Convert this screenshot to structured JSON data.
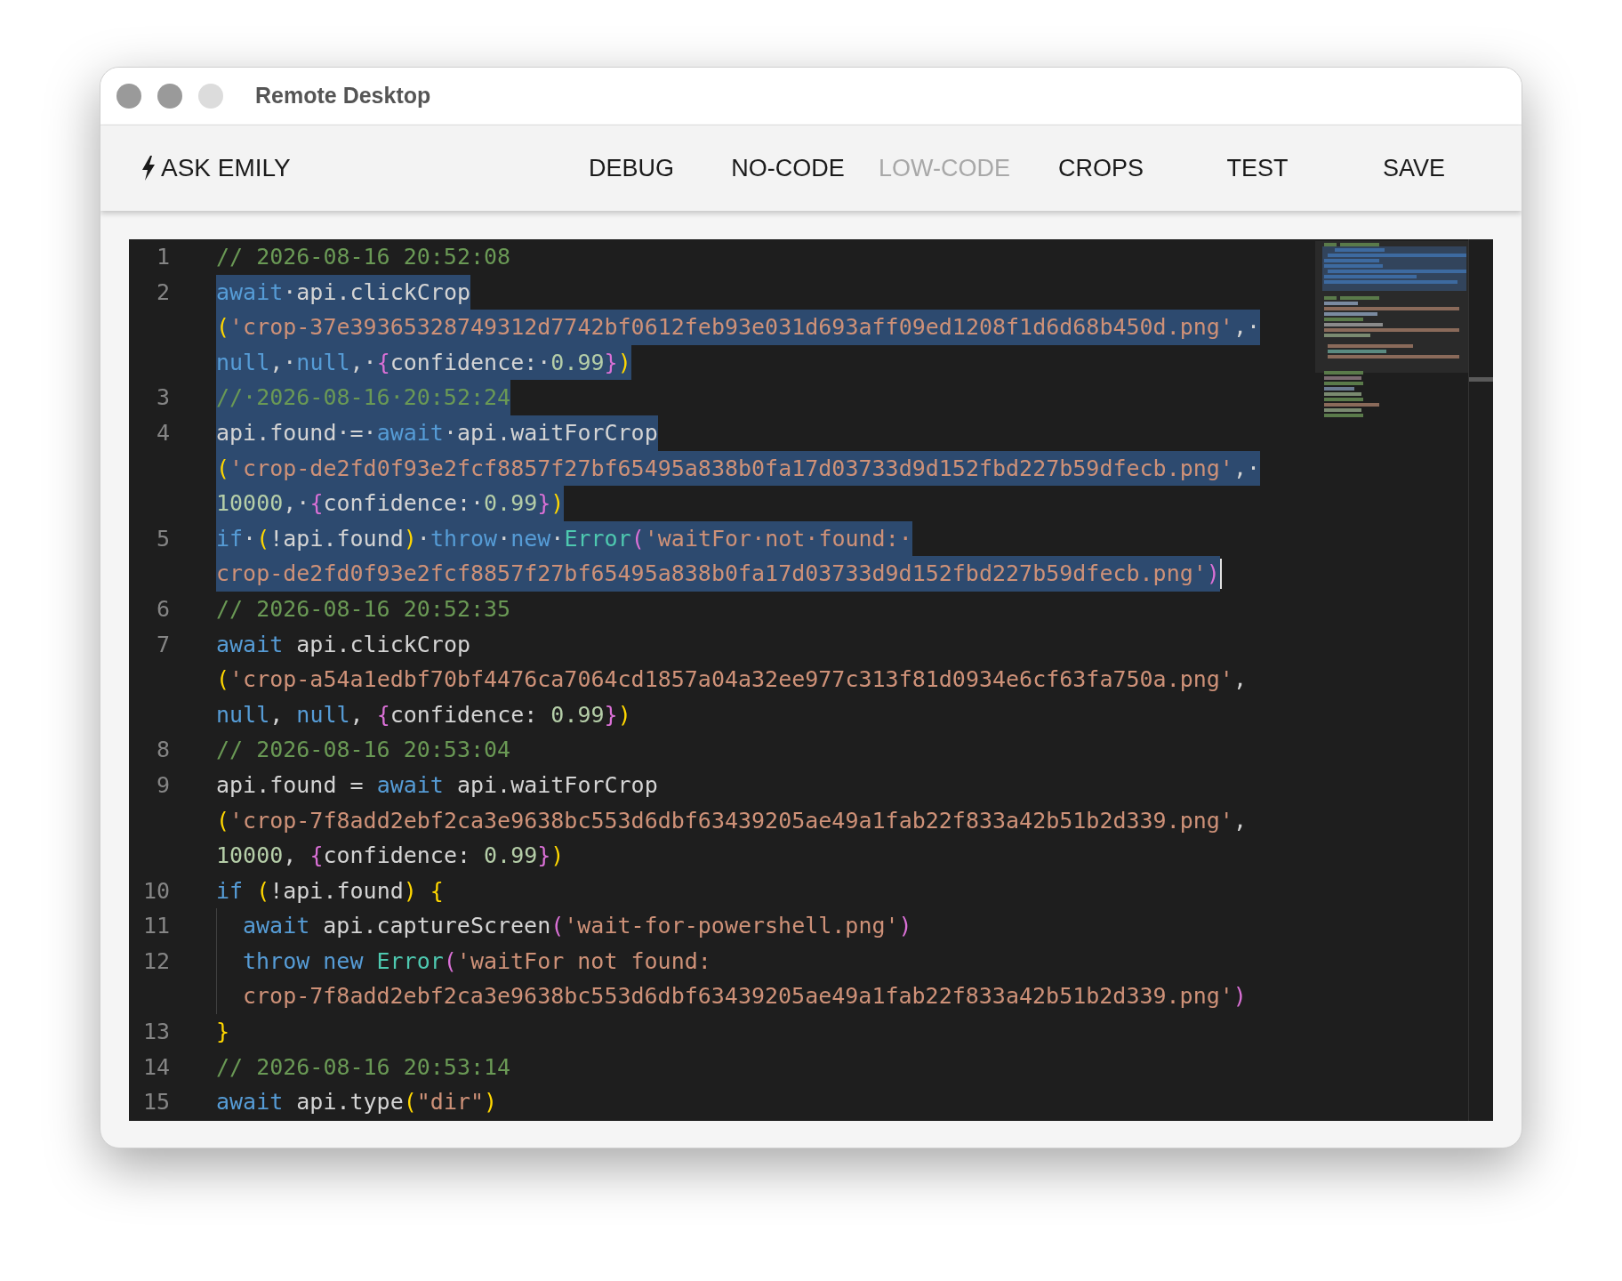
{
  "window": {
    "title": "Remote Desktop",
    "controls": [
      {
        "disabled": false
      },
      {
        "disabled": false
      },
      {
        "disabled": true
      }
    ]
  },
  "toolbar": {
    "ask_button": {
      "label": "ASK EMILY"
    },
    "items": [
      {
        "label": "DEBUG",
        "disabled": false
      },
      {
        "label": "NO-CODE",
        "disabled": false
      },
      {
        "label": "LOW-CODE",
        "disabled": true
      },
      {
        "label": "CROPS",
        "disabled": false
      },
      {
        "label": "TEST",
        "disabled": false
      },
      {
        "label": "SAVE",
        "disabled": false
      }
    ]
  },
  "editor": {
    "lines": [
      {
        "number": "1",
        "selected": false,
        "rows": [
          {
            "tokens": [
              {
                "kind": "comment",
                "text": "// 2026-08-16 20:52:08"
              }
            ]
          }
        ]
      },
      {
        "number": "2",
        "selected": true,
        "rows": [
          {
            "tokens": [
              {
                "kind": "keyword",
                "text": "await"
              },
              {
                "kind": "plain",
                "text": "·api.clickCrop"
              }
            ]
          },
          {
            "tokens": [
              {
                "kind": "paren",
                "text": "("
              },
              {
                "kind": "string",
                "text": "'crop-37e39365328749312d7742bf0612feb93e031d693aff09ed1208f1d6d68b450d.png'"
              },
              {
                "kind": "plain",
                "text": ",·"
              }
            ]
          },
          {
            "tokens": [
              {
                "kind": "keyword",
                "text": "null"
              },
              {
                "kind": "plain",
                "text": ",·"
              },
              {
                "kind": "keyword",
                "text": "null"
              },
              {
                "kind": "plain",
                "text": ",·"
              },
              {
                "kind": "brace",
                "text": "{"
              },
              {
                "kind": "plain",
                "text": "confidence:·"
              },
              {
                "kind": "number",
                "text": "0.99"
              },
              {
                "kind": "brace",
                "text": "}"
              },
              {
                "kind": "paren",
                "text": ")"
              }
            ]
          }
        ]
      },
      {
        "number": "3",
        "selected": true,
        "rows": [
          {
            "tokens": [
              {
                "kind": "comment",
                "text": "//·2026-08-16·20:52:24"
              }
            ]
          }
        ]
      },
      {
        "number": "4",
        "selected": true,
        "rows": [
          {
            "tokens": [
              {
                "kind": "plain",
                "text": "api.found·=·"
              },
              {
                "kind": "keyword",
                "text": "await"
              },
              {
                "kind": "plain",
                "text": "·api.waitForCrop"
              }
            ]
          },
          {
            "tokens": [
              {
                "kind": "paren",
                "text": "("
              },
              {
                "kind": "string",
                "text": "'crop-de2fd0f93e2fcf8857f27bf65495a838b0fa17d03733d9d152fbd227b59dfecb.png'"
              },
              {
                "kind": "plain",
                "text": ",·"
              }
            ]
          },
          {
            "tokens": [
              {
                "kind": "number",
                "text": "10000"
              },
              {
                "kind": "plain",
                "text": ",·"
              },
              {
                "kind": "brace",
                "text": "{"
              },
              {
                "kind": "plain",
                "text": "confidence:·"
              },
              {
                "kind": "number",
                "text": "0.99"
              },
              {
                "kind": "brace",
                "text": "}"
              },
              {
                "kind": "paren",
                "text": ")"
              }
            ]
          }
        ]
      },
      {
        "number": "5",
        "selected": true,
        "cursor": true,
        "rows": [
          {
            "tokens": [
              {
                "kind": "keyword",
                "text": "if"
              },
              {
                "kind": "plain",
                "text": "·"
              },
              {
                "kind": "paren",
                "text": "("
              },
              {
                "kind": "plain",
                "text": "!api.found"
              },
              {
                "kind": "paren",
                "text": ")"
              },
              {
                "kind": "plain",
                "text": "·"
              },
              {
                "kind": "keyword",
                "text": "throw"
              },
              {
                "kind": "plain",
                "text": "·"
              },
              {
                "kind": "keyword",
                "text": "new"
              },
              {
                "kind": "plain",
                "text": "·"
              },
              {
                "kind": "type",
                "text": "Error"
              },
              {
                "kind": "brace",
                "text": "("
              },
              {
                "kind": "string",
                "text": "'waitFor·not·found:·"
              }
            ]
          },
          {
            "tokens": [
              {
                "kind": "string",
                "text": "crop-de2fd0f93e2fcf8857f27bf65495a838b0fa17d03733d9d152fbd227b59dfecb.png'"
              },
              {
                "kind": "brace",
                "text": ")"
              }
            ]
          }
        ]
      },
      {
        "number": "6",
        "selected": false,
        "rows": [
          {
            "tokens": [
              {
                "kind": "comment",
                "text": "// 2026-08-16 20:52:35"
              }
            ]
          }
        ]
      },
      {
        "number": "7",
        "selected": false,
        "rows": [
          {
            "tokens": [
              {
                "kind": "keyword",
                "text": "await"
              },
              {
                "kind": "plain",
                "text": " api.clickCrop"
              }
            ]
          },
          {
            "tokens": [
              {
                "kind": "paren",
                "text": "("
              },
              {
                "kind": "string",
                "text": "'crop-a54a1edbf70bf4476ca7064cd1857a04a32ee977c313f81d0934e6cf63fa750a.png'"
              },
              {
                "kind": "plain",
                "text": ","
              }
            ]
          },
          {
            "tokens": [
              {
                "kind": "keyword",
                "text": "null"
              },
              {
                "kind": "plain",
                "text": ", "
              },
              {
                "kind": "keyword",
                "text": "null"
              },
              {
                "kind": "plain",
                "text": ", "
              },
              {
                "kind": "brace",
                "text": "{"
              },
              {
                "kind": "plain",
                "text": "confidence: "
              },
              {
                "kind": "number",
                "text": "0.99"
              },
              {
                "kind": "brace",
                "text": "}"
              },
              {
                "kind": "paren",
                "text": ")"
              }
            ]
          }
        ]
      },
      {
        "number": "8",
        "selected": false,
        "rows": [
          {
            "tokens": [
              {
                "kind": "comment",
                "text": "// 2026-08-16 20:53:04"
              }
            ]
          }
        ]
      },
      {
        "number": "9",
        "selected": false,
        "rows": [
          {
            "tokens": [
              {
                "kind": "plain",
                "text": "api.found = "
              },
              {
                "kind": "keyword",
                "text": "await"
              },
              {
                "kind": "plain",
                "text": " api.waitForCrop"
              }
            ]
          },
          {
            "tokens": [
              {
                "kind": "paren",
                "text": "("
              },
              {
                "kind": "string",
                "text": "'crop-7f8add2ebf2ca3e9638bc553d6dbf63439205ae49a1fab22f833a42b51b2d339.png'"
              },
              {
                "kind": "plain",
                "text": ","
              }
            ]
          },
          {
            "tokens": [
              {
                "kind": "number",
                "text": "10000"
              },
              {
                "kind": "plain",
                "text": ", "
              },
              {
                "kind": "brace",
                "text": "{"
              },
              {
                "kind": "plain",
                "text": "confidence: "
              },
              {
                "kind": "number",
                "text": "0.99"
              },
              {
                "kind": "brace",
                "text": "}"
              },
              {
                "kind": "paren",
                "text": ")"
              }
            ]
          }
        ]
      },
      {
        "number": "10",
        "selected": false,
        "rows": [
          {
            "tokens": [
              {
                "kind": "keyword",
                "text": "if"
              },
              {
                "kind": "paren",
                "text": " ("
              },
              {
                "kind": "plain",
                "text": "!api.found"
              },
              {
                "kind": "paren",
                "text": ") {"
              }
            ]
          }
        ],
        "children": [
          {
            "number": "11",
            "selected": false,
            "rows": [
              {
                "tokens": [
                  {
                    "kind": "keyword",
                    "text": "await"
                  },
                  {
                    "kind": "plain",
                    "text": " api.captureScreen"
                  },
                  {
                    "kind": "brace",
                    "text": "("
                  },
                  {
                    "kind": "string",
                    "text": "'wait-for-powershell.png'"
                  },
                  {
                    "kind": "brace",
                    "text": ")"
                  }
                ]
              }
            ]
          },
          {
            "number": "12",
            "selected": false,
            "rows": [
              {
                "tokens": [
                  {
                    "kind": "keyword",
                    "text": "throw new"
                  },
                  {
                    "kind": "type",
                    "text": " Error"
                  },
                  {
                    "kind": "brace",
                    "text": "("
                  },
                  {
                    "kind": "string",
                    "text": "'waitFor not found:"
                  }
                ]
              },
              {
                "tokens": [
                  {
                    "kind": "string",
                    "text": "crop-7f8add2ebf2ca3e9638bc553d6dbf63439205ae49a1fab22f833a42b51b2d339.png'"
                  },
                  {
                    "kind": "brace",
                    "text": ")"
                  }
                ]
              }
            ]
          }
        ]
      },
      {
        "number": "13",
        "selected": false,
        "rows": [
          {
            "tokens": [
              {
                "kind": "paren",
                "text": "}"
              }
            ]
          }
        ]
      },
      {
        "number": "14",
        "selected": false,
        "rows": [
          {
            "tokens": [
              {
                "kind": "comment",
                "text": "// 2026-08-16 20:53:14"
              }
            ]
          }
        ]
      },
      {
        "number": "15",
        "selected": false,
        "rows": [
          {
            "tokens": [
              {
                "kind": "keyword",
                "text": "await"
              },
              {
                "kind": "plain",
                "text": " api.type"
              },
              {
                "kind": "paren",
                "text": "("
              },
              {
                "kind": "string",
                "text": "\"dir\""
              },
              {
                "kind": "paren",
                "text": ")"
              }
            ]
          }
        ]
      }
    ]
  }
}
